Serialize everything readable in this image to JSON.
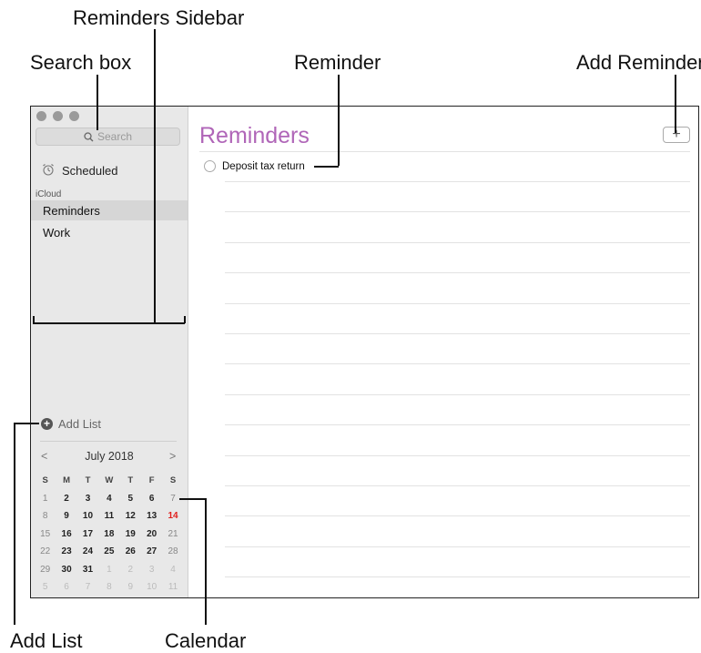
{
  "callouts": {
    "reminders_sidebar": "Reminders Sidebar",
    "search_box": "Search box",
    "reminder": "Reminder",
    "add_reminder": "Add Reminder",
    "add_list": "Add List",
    "calendar": "Calendar"
  },
  "sidebar": {
    "search_placeholder": "Search",
    "scheduled": "Scheduled",
    "section": "iCloud",
    "lists": [
      "Reminders",
      "Work"
    ],
    "add_list": "Add List"
  },
  "calendar": {
    "prev": "<",
    "next": ">",
    "title": "July 2018",
    "weekdays": [
      "S",
      "M",
      "T",
      "W",
      "T",
      "F",
      "S"
    ],
    "weeks": [
      [
        "1",
        "2",
        "3",
        "4",
        "5",
        "6",
        "7"
      ],
      [
        "8",
        "9",
        "10",
        "11",
        "12",
        "13",
        "14"
      ],
      [
        "15",
        "16",
        "17",
        "18",
        "19",
        "20",
        "21"
      ],
      [
        "22",
        "23",
        "24",
        "25",
        "26",
        "27",
        "28"
      ],
      [
        "29",
        "30",
        "31",
        "1",
        "2",
        "3",
        "4"
      ],
      [
        "5",
        "6",
        "7",
        "8",
        "9",
        "10",
        "11"
      ]
    ],
    "today": "14"
  },
  "main": {
    "title": "Reminders",
    "add_button": "+",
    "reminders": [
      "Deposit tax return"
    ]
  },
  "colors": {
    "title": "#b066b8",
    "today": "#e0201e",
    "sidebar_bg": "#e8e8e8"
  }
}
